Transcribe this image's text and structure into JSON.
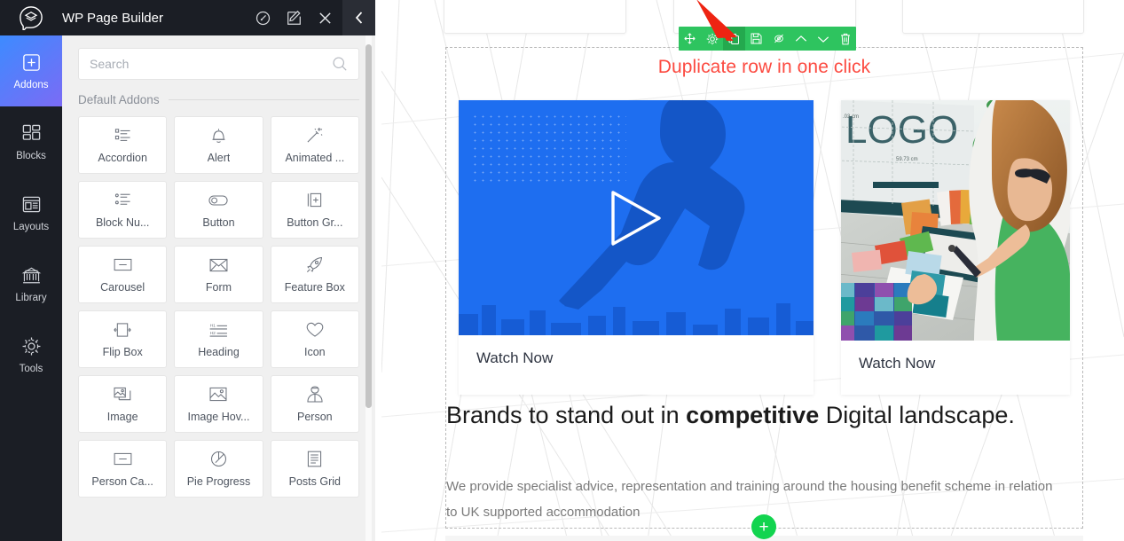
{
  "panel": {
    "title": "WP Page Builder",
    "logo_icon": "wp-pagebuilder-logo-icon",
    "header_icons": [
      {
        "name": "speedometer-icon",
        "glyph": "speedometer"
      },
      {
        "name": "edit-icon",
        "glyph": "edit"
      },
      {
        "name": "close-icon",
        "glyph": "close"
      }
    ],
    "collapse_icon": "chevron-left-icon",
    "rail": [
      {
        "label": "Addons",
        "icon": "plus-square-icon",
        "active": true
      },
      {
        "label": "Blocks",
        "icon": "blocks-grid-icon",
        "active": false
      },
      {
        "label": "Layouts",
        "icon": "layout-icon",
        "active": false
      },
      {
        "label": "Library",
        "icon": "library-bank-icon",
        "active": false
      },
      {
        "label": "Tools",
        "icon": "gear-icon",
        "active": false
      }
    ],
    "search": {
      "placeholder": "Search",
      "value": "",
      "icon": "search-icon"
    },
    "section_title": "Default Addons",
    "addons": [
      {
        "label": "Accordion",
        "icon": "list-accordion-icon"
      },
      {
        "label": "Alert",
        "icon": "bell-icon"
      },
      {
        "label": "Animated ...",
        "icon": "magic-wand-icon"
      },
      {
        "label": "Block Nu...",
        "icon": "numbered-list-icon"
      },
      {
        "label": "Button",
        "icon": "toggle-button-icon"
      },
      {
        "label": "Button Gr...",
        "icon": "button-group-icon"
      },
      {
        "label": "Carousel",
        "icon": "carousel-icon"
      },
      {
        "label": "Form",
        "icon": "envelope-icon"
      },
      {
        "label": "Feature Box",
        "icon": "rocket-icon"
      },
      {
        "label": "Flip Box",
        "icon": "flip-box-icon"
      },
      {
        "label": "Heading",
        "icon": "heading-h1-h2-icon"
      },
      {
        "label": "Icon",
        "icon": "heart-icon"
      },
      {
        "label": "Image",
        "icon": "images-stack-icon"
      },
      {
        "label": "Image Hov...",
        "icon": "image-icon"
      },
      {
        "label": "Person",
        "icon": "person-icon"
      },
      {
        "label": "Person Ca...",
        "icon": "person-carousel-icon"
      },
      {
        "label": "Pie Progress",
        "icon": "pie-progress-icon"
      },
      {
        "label": "Posts Grid",
        "icon": "posts-grid-icon"
      }
    ]
  },
  "canvas": {
    "row_toolbar": {
      "background_color": "#2ec45f",
      "buttons": [
        {
          "name": "move-row-icon",
          "label": "Move",
          "active": false
        },
        {
          "name": "row-settings-icon",
          "label": "Settings",
          "active": false
        },
        {
          "name": "duplicate-row-icon",
          "label": "Duplicate",
          "active": true
        },
        {
          "name": "save-row-icon",
          "label": "Save",
          "active": false
        },
        {
          "name": "hide-row-icon",
          "label": "Hide",
          "active": false
        },
        {
          "name": "move-up-icon",
          "label": "Move Up",
          "active": false
        },
        {
          "name": "move-down-icon",
          "label": "Move Down",
          "active": false
        },
        {
          "name": "delete-row-icon",
          "label": "Delete",
          "active": false
        }
      ]
    },
    "annotation": {
      "text": "Duplicate row in one click",
      "color": "#fc4a40",
      "arrow_color": "#ee2412"
    },
    "left_column": {
      "media_type": "video-thumbnail",
      "play_icon": "play-triangle-icon",
      "caption": "Watch Now"
    },
    "right_column": {
      "media_type": "photo-designer-color-swatches",
      "photo_text": "LOGO",
      "caption": "Watch Now"
    },
    "headline": {
      "before": "Brands to stand out in ",
      "bold": "competitive",
      "after": " Digital landscape."
    },
    "subtext": "We provide specialist advice, representation and training around the housing benefit scheme in relation to UK supported accommodation",
    "add_row_button": {
      "label": "+",
      "color": "#12d44f",
      "name": "add-row-button"
    }
  }
}
